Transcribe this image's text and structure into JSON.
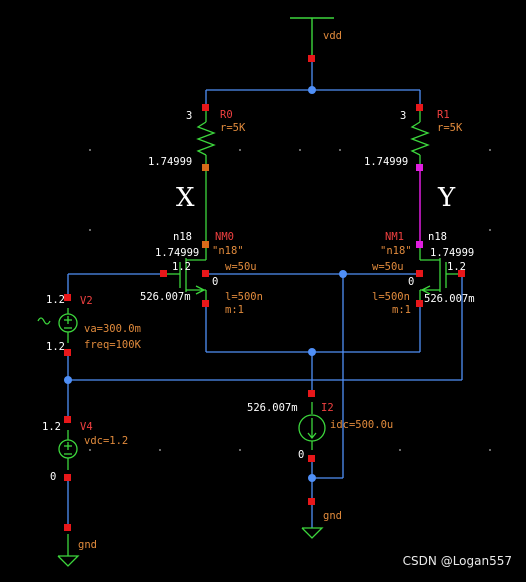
{
  "colors": {
    "background": "#000000",
    "wire": "#4f8ff7",
    "component": "#3cd63c",
    "pin": "#e8171a",
    "label_red": "#f04040",
    "label_orange": "#e08a3c",
    "net_text": "#ffffff",
    "selected_wire": "#e01ee0"
  },
  "labels": {
    "vdd_top": "vdd",
    "node_x": "X",
    "node_y": "Y",
    "r0_name": "R0",
    "r0_value": "r=5K",
    "r0_top_node": "3",
    "r0_bottom_v": "1.74999",
    "r1_name": "R1",
    "r1_value": "r=5K",
    "r1_top_node": "3",
    "r1_bottom_v": "1.74999",
    "nm0_name": "NM0",
    "nm0_model_tag": "n18",
    "nm0_model": "\"n18\"",
    "nm0_drain_v": "1.74999",
    "nm0_gate_v": "1.2",
    "nm0_w": "w=50u",
    "nm0_bulk": "0",
    "nm0_l": "l=500n",
    "nm0_m": "m:1",
    "nm0_source_v": "526.007m",
    "nm1_name": "NM1",
    "nm1_model_tag": "n18",
    "nm1_model": "\"n18\"",
    "nm1_drain_v": "1.74999",
    "nm1_gate_v": "1.2",
    "nm1_w": "w=50u",
    "nm1_bulk": "0",
    "nm1_l": "l=500n",
    "nm1_m": "m:1",
    "nm1_source_v": "526.007m",
    "v2_name": "V2",
    "v2_top_v": "1.2",
    "v2_va": "va=300.0m",
    "v2_freq": "freq=100K",
    "v2_bottom_v": "1.2",
    "v4_name": "V4",
    "v4_top_v": "1.2",
    "v4_vdc": "vdc=1.2",
    "v4_bottom_v": "0",
    "i2_name": "I2",
    "i2_top_v": "526.007m",
    "i2_idc": "idc=500.0u",
    "i2_bottom_v": "0",
    "gnd_left": "gnd",
    "gnd_mid": "gnd",
    "watermark": "CSDN @Logan557"
  }
}
